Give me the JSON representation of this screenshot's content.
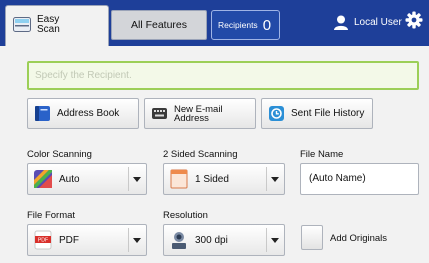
{
  "header": {
    "tabs": {
      "easy_scan": "Easy\nScan",
      "all_features": "All Features"
    },
    "recipients": {
      "label": "Recipients",
      "count": "0"
    },
    "user": {
      "label": "Local User",
      "icon": "user-icon"
    },
    "settings_icon": "gear-icon",
    "colors": {
      "bar": "#1e3f99",
      "accent_green": "#9ccf57"
    }
  },
  "recipient_field": {
    "value": "",
    "placeholder": "Specify the Recipient."
  },
  "actions": {
    "address_book": "Address Book",
    "new_email": "New E-mail\nAddress",
    "sent_history": "Sent File History"
  },
  "settings": {
    "color_scanning": {
      "label": "Color Scanning",
      "value": "Auto"
    },
    "two_sided": {
      "label": "2 Sided Scanning",
      "value": "1 Sided"
    },
    "file_name": {
      "label": "File Name",
      "value": "(Auto Name)"
    },
    "file_format": {
      "label": "File Format",
      "value": "PDF"
    },
    "resolution": {
      "label": "Resolution",
      "value": "300 dpi"
    },
    "add_originals": {
      "label": "Add Originals",
      "checked": false
    }
  }
}
